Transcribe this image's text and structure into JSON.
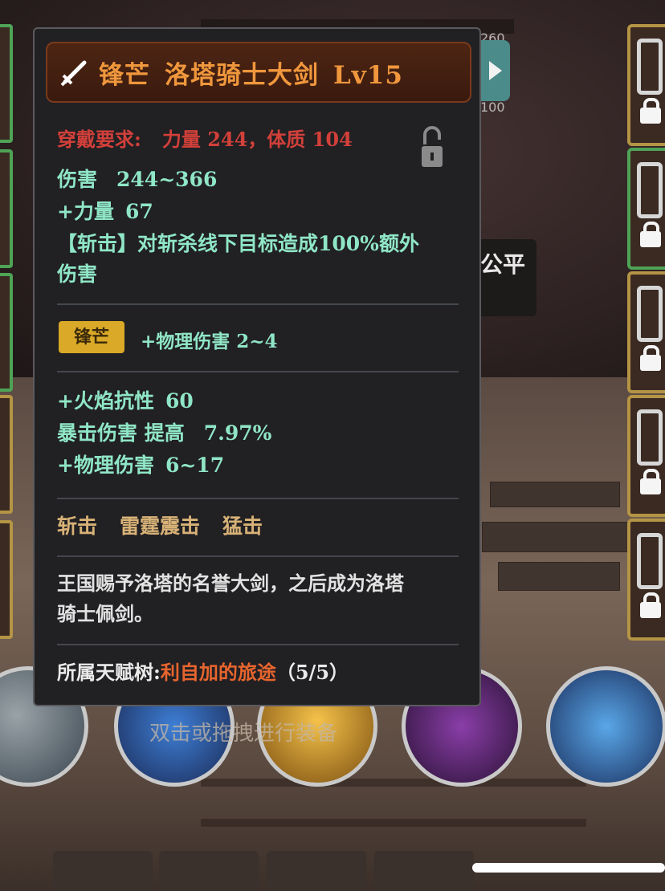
{
  "tooltip": {
    "title": {
      "name": "锋芒",
      "weapon": "洛塔骑士大剑",
      "level": "Lv15"
    },
    "requirement": {
      "label": "穿戴要求:",
      "value": "力量 244，体质 104"
    },
    "base_stats": [
      {
        "label": "伤害",
        "value": "244~366"
      },
      {
        "label": "+力量",
        "value": "67"
      }
    ],
    "effect_line1": "【斩击】对斩杀线下目标造成100%额外",
    "effect_line2": "伤害",
    "affix": {
      "badge": "锋芒",
      "text": "+物理伤害  2~4"
    },
    "extra_stats": [
      {
        "label": "+火焰抗性",
        "value": "60"
      },
      {
        "label": "暴击伤害  提高",
        "value": "7.97%"
      },
      {
        "label": "+物理伤害",
        "value": "6~17"
      }
    ],
    "skills": [
      "斩击",
      "雷霆震击",
      "猛击"
    ],
    "description_line1": "王国赐予洛塔的名誉大剑，之后成为洛塔",
    "description_line2": "骑士佩剑。",
    "talent": {
      "label": "所属天赋树:",
      "name": "利自加的旅途",
      "count": "（5/5）"
    }
  },
  "background": {
    "num_top": "260",
    "num_bottom": "100",
    "npc_label": "公平",
    "hint": "双击或拖拽进行装备"
  },
  "colors": {
    "title_orange": "#f0973d",
    "requirement_red": "#d2403a",
    "stat_green": "#8fe6c6",
    "skill_gold": "#d8b277",
    "talent_orange": "#e7652e",
    "badge_gold": "#d9a927"
  }
}
